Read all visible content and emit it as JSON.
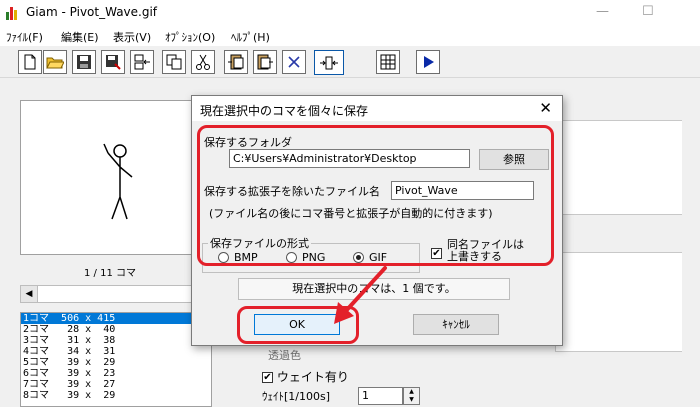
{
  "window": {
    "title": "Giam - Pivot_Wave.gif",
    "controls": {
      "minimize": "—",
      "maximize": "☐"
    }
  },
  "menu": [
    "ﾌｧｲﾙ(F)",
    "編集(E)",
    "表示(V)",
    "ｵﾌﾟｼｮﾝ(O)",
    "ﾍﾙﾌﾟ(H)"
  ],
  "toolbar": {
    "icons": [
      "new-file-icon",
      "open-folder-icon",
      "save-icon",
      "save-as-icon",
      "insert-frame-icon",
      "copy-icon",
      "cut-icon",
      "paste-before-icon",
      "paste-after-icon",
      "delete-icon",
      "frame-resize-icon",
      "grid-icon",
      "play-icon"
    ]
  },
  "preview": {
    "frame_indicator": "1 / 11 コマ"
  },
  "frame_list": [
    "1コマ  506 x 415",
    "2コマ   28 x  40",
    "3コマ   31 x  38",
    "4コマ   34 x  31",
    "5コマ   39 x  29",
    "6コマ   39 x  23",
    "7コマ   39 x  27",
    "8コマ   39 x  29"
  ],
  "right_panel": {
    "transparent_label": "透過色",
    "wait_label": "ウェイト有り",
    "wait_unit_label": "ｳｪｲﾄ[1/100s]",
    "wait_value": "1"
  },
  "dialog": {
    "title": "現在選択中のコマを個々に保存",
    "close_glyph": "✕",
    "folder_label": "保存するフォルダ",
    "folder_value": "C:¥Users¥Administrator¥Desktop",
    "browse_button": "参照",
    "filename_label": "保存する拡張子を除いたファイル名",
    "filename_value": "Pivot_Wave",
    "note": "(ファイル名の後にコマ番号と拡張子が自動的に付きます)",
    "format_group_label": "保存ファイルの形式",
    "formats": [
      {
        "label": "BMP",
        "selected": false
      },
      {
        "label": "PNG",
        "selected": false
      },
      {
        "label": "GIF",
        "selected": true
      }
    ],
    "overwrite_line1": "同名ファイルは",
    "overwrite_line2": "上書きする",
    "overwrite_checked": true,
    "status": "現在選択中のコマは、1 個です。",
    "ok_button": "OK",
    "cancel_button": "ｷｬﾝｾﾙ"
  },
  "colors": {
    "highlight": "#e3202a",
    "selection": "#0078d7"
  }
}
